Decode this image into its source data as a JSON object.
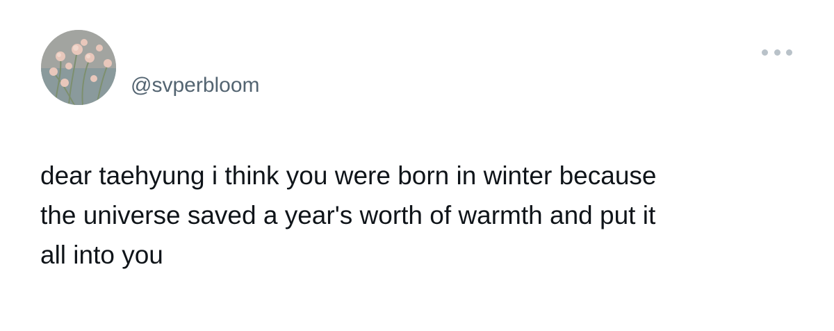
{
  "tweet": {
    "handle": "@svperbloom",
    "text": "dear taehyung i think you were born in winter because\nthe universe saved a year's worth of warmth and put it\nall into you",
    "avatar_icon": "flower-photo-avatar",
    "more_icon": "more-options-icon"
  },
  "colors": {
    "text": "#0f1419",
    "handle": "#536471",
    "more_dots": "#b9c2c9",
    "background": "#ffffff"
  }
}
